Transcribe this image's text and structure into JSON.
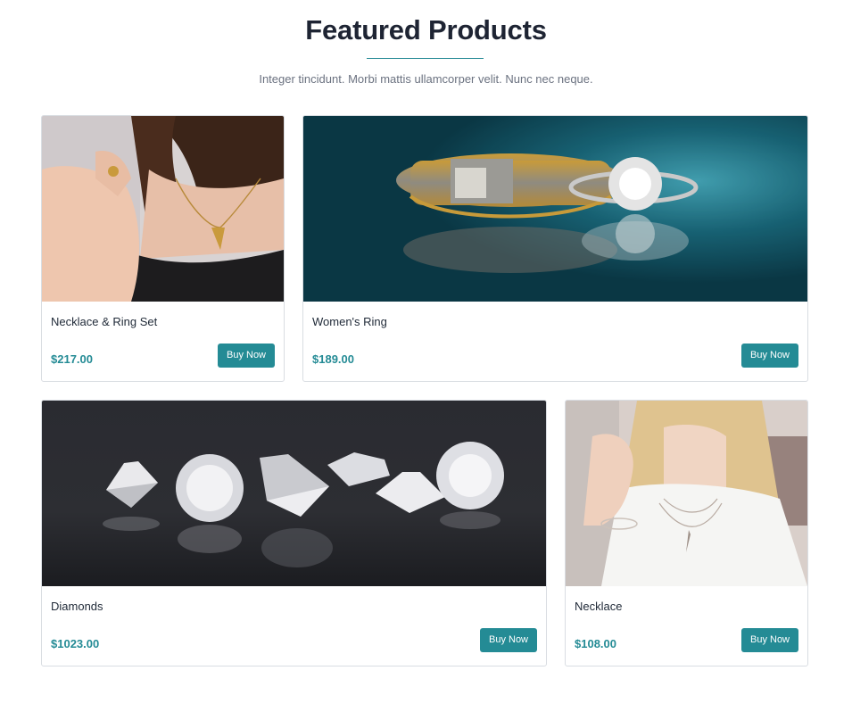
{
  "header": {
    "title": "Featured Products",
    "subtitle": "Integer tincidunt. Morbi mattis ullamcorper velit. Nunc nec neque."
  },
  "products": [
    {
      "name": "Necklace & Ring Set",
      "price": "$217.00",
      "button": "Buy Now"
    },
    {
      "name": "Women's Ring",
      "price": "$189.00",
      "button": "Buy Now"
    },
    {
      "name": "Diamonds",
      "price": "$1023.00",
      "button": "Buy Now"
    },
    {
      "name": "Necklace",
      "price": "$108.00",
      "button": "Buy Now"
    }
  ],
  "colors": {
    "accent": "#248b95",
    "title": "#1e2433",
    "subtitle": "#6b7280",
    "border": "#d9dde2"
  }
}
